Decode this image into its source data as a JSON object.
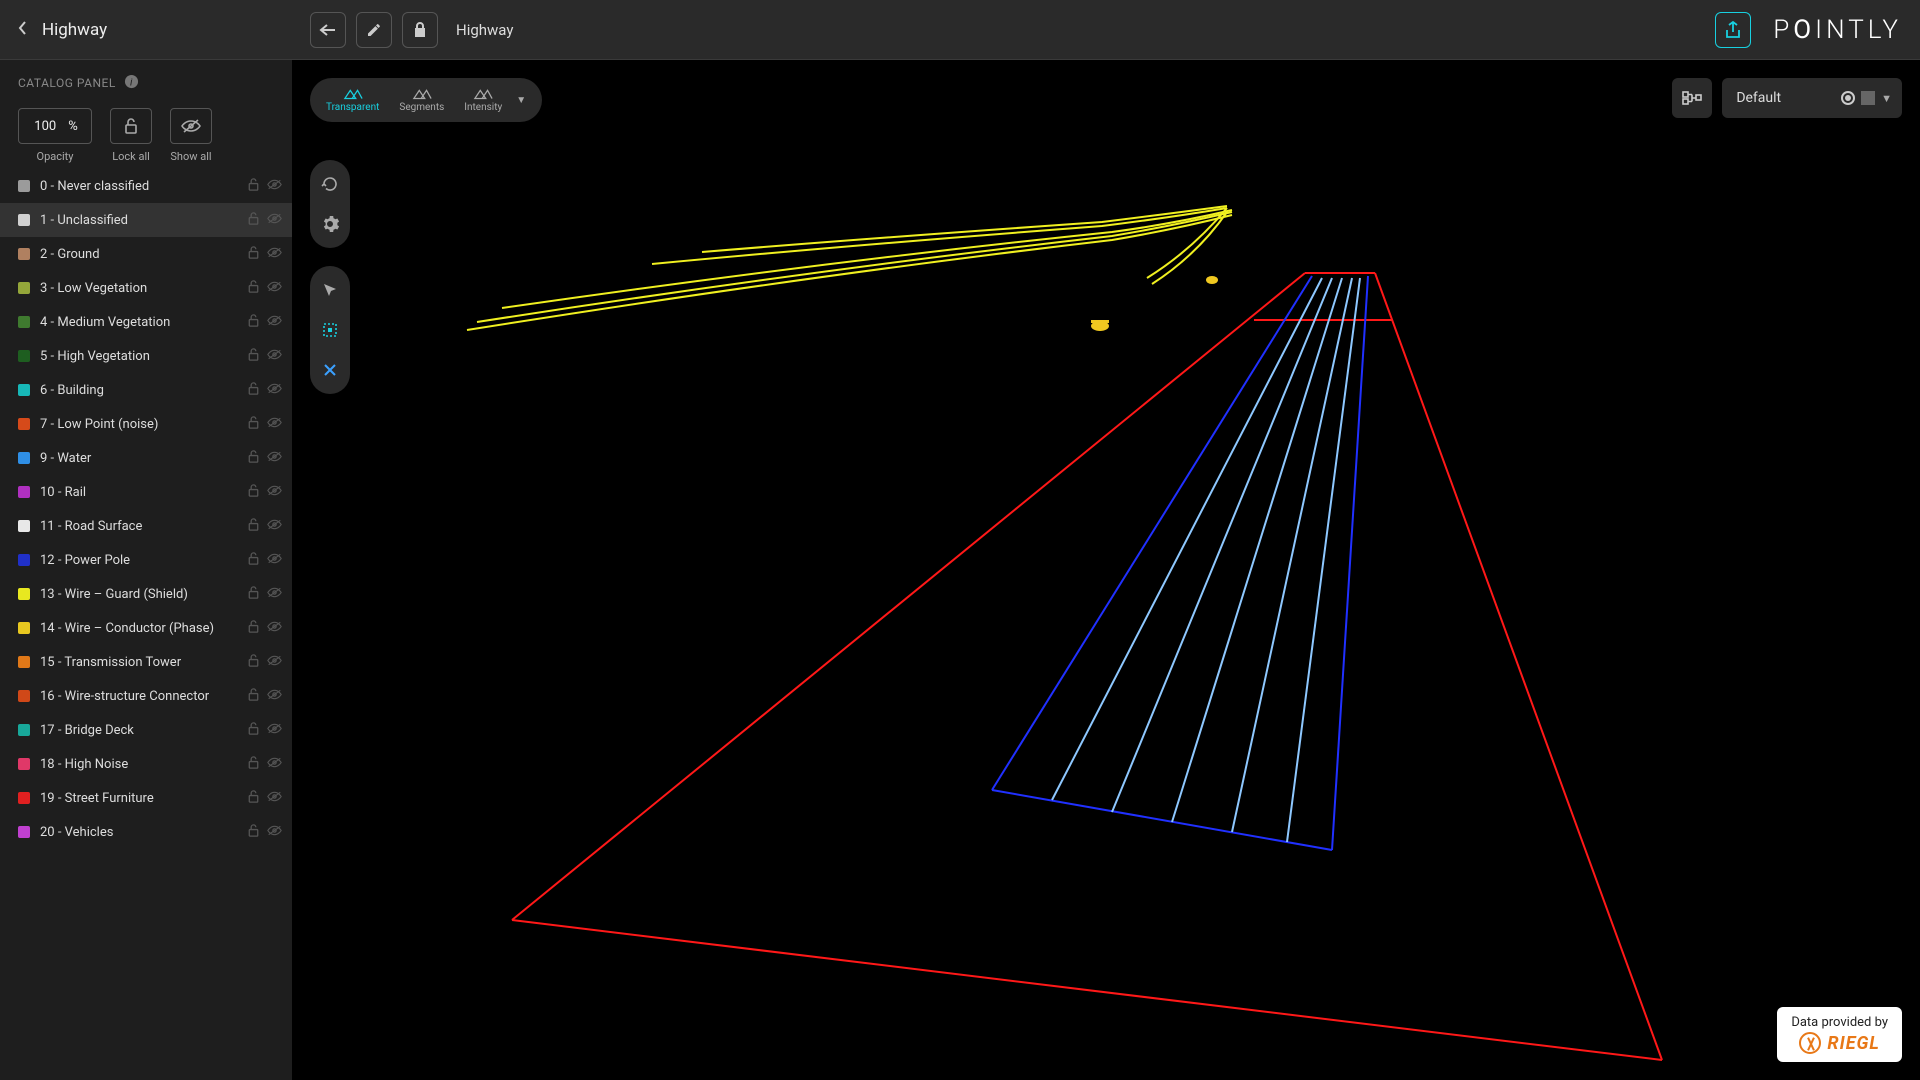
{
  "header": {
    "title": "Highway",
    "breadcrumb": "Highway",
    "brand": "POINTLY"
  },
  "sidebar": {
    "panel_label": "CATALOG PANEL",
    "opacity": {
      "value": "100",
      "unit": "%",
      "label": "Opacity"
    },
    "lock_all_label": "Lock all",
    "show_all_label": "Show all",
    "classes": [
      {
        "label": "0 - Never classified",
        "color": "#9b9b9b",
        "selected": false
      },
      {
        "label": "1 - Unclassified",
        "color": "#d0d0d0",
        "selected": true
      },
      {
        "label": "2 - Ground",
        "color": "#b08060",
        "selected": false
      },
      {
        "label": "3 - Low Vegetation",
        "color": "#94a63a",
        "selected": false
      },
      {
        "label": "4 - Medium Vegetation",
        "color": "#3f7a2f",
        "selected": false
      },
      {
        "label": "5 - High Vegetation",
        "color": "#1e5e20",
        "selected": false
      },
      {
        "label": "6 - Building",
        "color": "#17b8b8",
        "selected": false
      },
      {
        "label": "7 - Low Point (noise)",
        "color": "#d64a1a",
        "selected": false
      },
      {
        "label": "9 - Water",
        "color": "#2f8fe6",
        "selected": false
      },
      {
        "label": "10 - Rail",
        "color": "#b030c0",
        "selected": false
      },
      {
        "label": "11 - Road Surface",
        "color": "#e8e8e8",
        "selected": false
      },
      {
        "label": "12 - Power Pole",
        "color": "#2030c8",
        "selected": false
      },
      {
        "label": "13 - Wire – Guard (Shield)",
        "color": "#e8e820",
        "selected": false
      },
      {
        "label": "14 - Wire – Conductor (Phase)",
        "color": "#e8c820",
        "selected": false
      },
      {
        "label": "15 - Transmission Tower",
        "color": "#e07818",
        "selected": false
      },
      {
        "label": "16 - Wire-structure Connector",
        "color": "#d04818",
        "selected": false
      },
      {
        "label": "17 - Bridge Deck",
        "color": "#18a89a",
        "selected": false
      },
      {
        "label": "18 - High Noise",
        "color": "#e03868",
        "selected": false
      },
      {
        "label": "19 - Street Furniture",
        "color": "#e02020",
        "selected": false
      },
      {
        "label": "20 - Vehicles",
        "color": "#c040d0",
        "selected": false
      }
    ]
  },
  "viewport": {
    "modes": [
      {
        "label": "Transparent",
        "active": true
      },
      {
        "label": "Segments",
        "active": false
      },
      {
        "label": "Intensity",
        "active": false
      }
    ],
    "view_preset": "Default",
    "attribution": {
      "prefix": "Data provided by",
      "company": "RIEGL"
    }
  }
}
